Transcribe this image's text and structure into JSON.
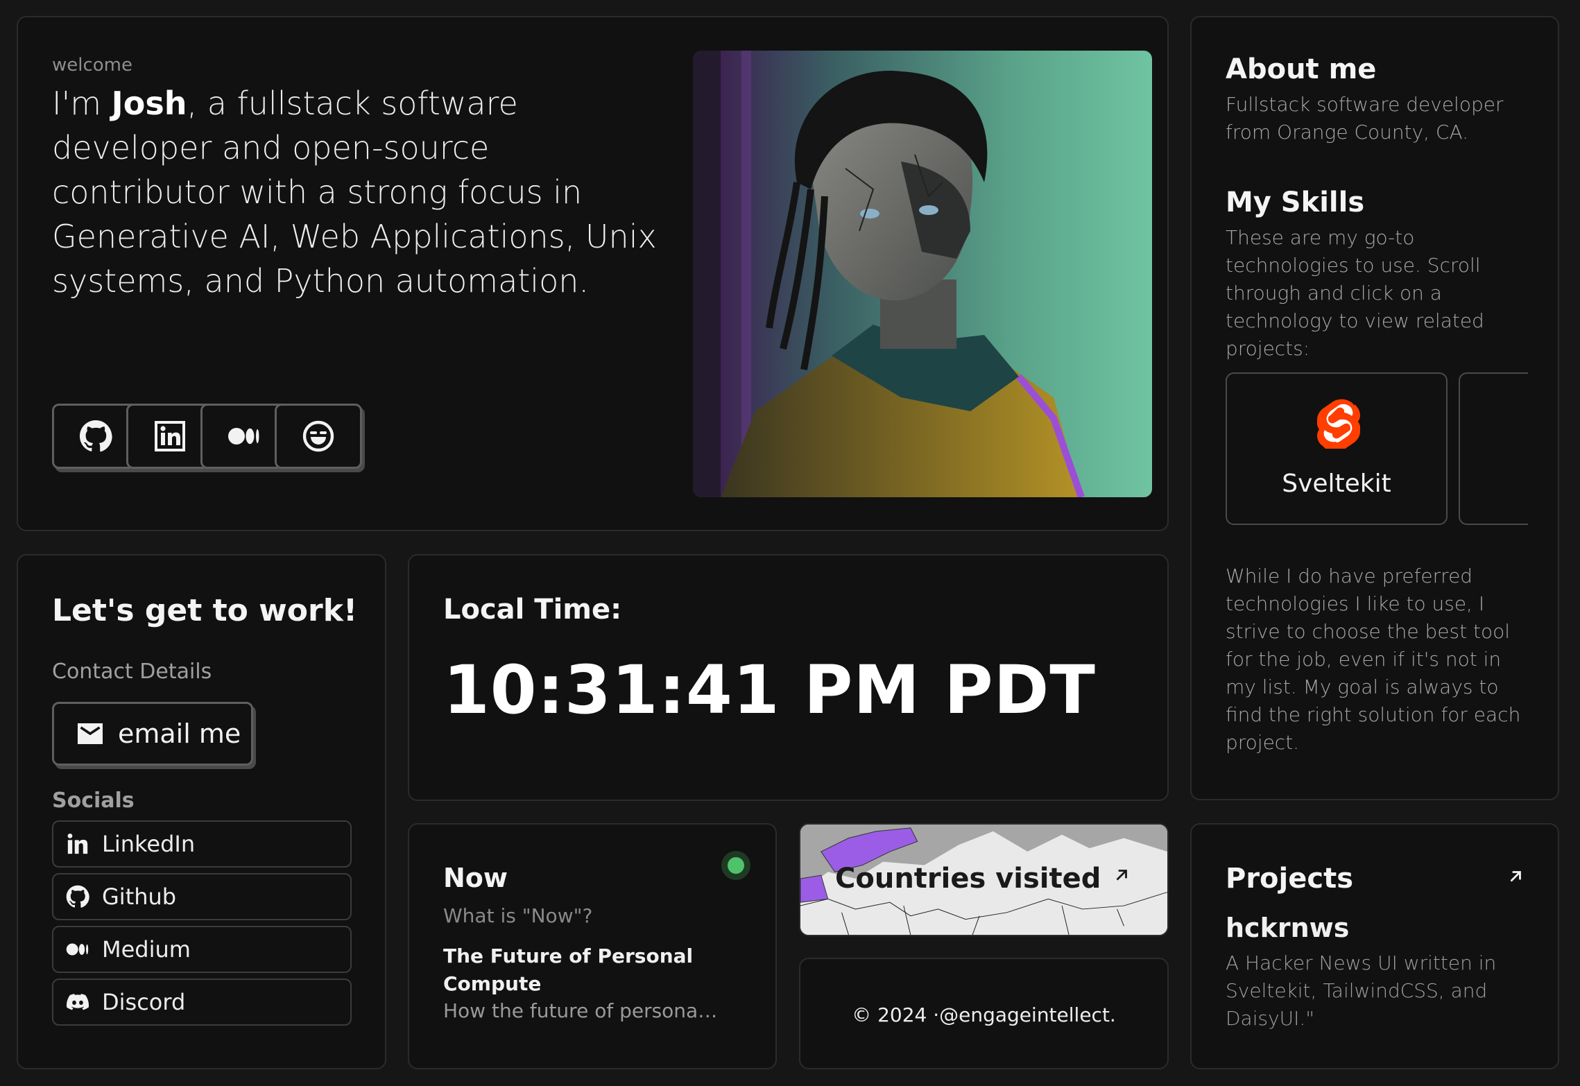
{
  "hero": {
    "welcome": "welcome",
    "intro_prefix": "I'm ",
    "intro_name": "Josh",
    "intro_rest": ", a fullstack software developer and open-source contributor with a strong focus in Generative AI, Web Applications, Unix systems, and Python automation.",
    "social_buttons": [
      {
        "icon": "github-icon"
      },
      {
        "icon": "linkedin-icon"
      },
      {
        "icon": "medium-icon"
      },
      {
        "icon": "laughing-face-icon"
      }
    ]
  },
  "about": {
    "title": "About me",
    "description": "Fullstack software developer from Orange County, CA.",
    "skills_title": "My Skills",
    "skills_description": "These are my go-to technologies to use. Scroll through and click on a technology to view related projects:",
    "skills": [
      {
        "name": "Sveltekit",
        "icon": "svelte-icon",
        "color": "#ff3e00"
      }
    ],
    "closing": "While I do have preferred technologies I like to use, I strive to choose the best tool for the job, even if it's not in my list. My goal is always to find the right solution for each project."
  },
  "contact": {
    "title": "Let's get to work!",
    "details_label": "Contact Details",
    "email_button": "email me",
    "socials_label": "Socials",
    "socials": [
      {
        "label": "LinkedIn",
        "icon": "linkedin-icon"
      },
      {
        "label": "Github",
        "icon": "github-icon"
      },
      {
        "label": "Medium",
        "icon": "medium-icon"
      },
      {
        "label": "Discord",
        "icon": "discord-icon"
      }
    ]
  },
  "time": {
    "label": "Local Time:",
    "value": "10:31:41 PM PDT"
  },
  "now": {
    "title": "Now",
    "question": "What is \"Now\"?",
    "article_title": "The Future of Personal Compute",
    "article_sub": "How the future of personal...",
    "status_color": "#4fc36a"
  },
  "countries": {
    "title": "Countries visited",
    "highlight_color": "#9b5de5"
  },
  "footer": {
    "text": "© 2024 ·@engageintellect."
  },
  "projects": {
    "title": "Projects",
    "name": "hckrnws",
    "description": "A Hacker News UI written in Sveltekit, TailwindCSS, and DaisyUI.\""
  }
}
